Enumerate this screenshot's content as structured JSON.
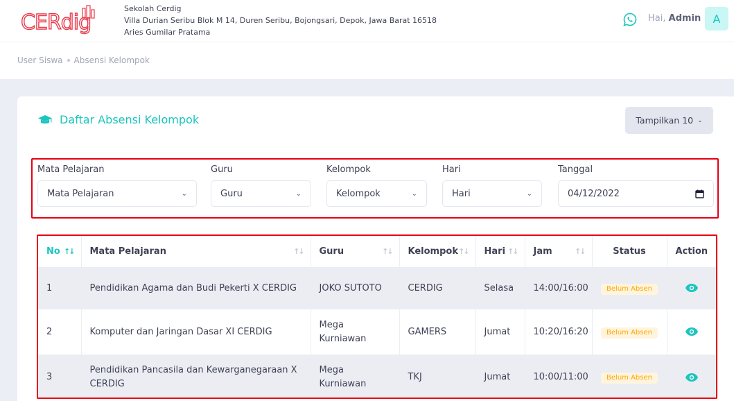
{
  "header": {
    "logo_text": "CERdig",
    "school_name": "Sekolah Cerdig",
    "school_address": "Villa Durian Seribu Blok M 14, Duren Seribu, Bojongsari, Depok, Jawa Barat 16518",
    "principal": "Aries Gumilar Pratama",
    "greeting": "Hai,",
    "user_name": "Admin",
    "avatar_initial": "A",
    "icons": [
      "whatsapp-icon"
    ]
  },
  "breadcrumb": {
    "items": [
      "User Siswa",
      "Absensi Kelompok"
    ]
  },
  "card": {
    "title": "Daftar Absensi Kelompok",
    "title_icon": "graduation-cap-icon",
    "show_label": "Tampilkan 10"
  },
  "filters": {
    "mapel": {
      "label": "Mata Pelajaran",
      "value": "Mata Pelajaran"
    },
    "guru": {
      "label": "Guru",
      "value": "Guru"
    },
    "kelompok": {
      "label": "Kelompok",
      "value": "Kelompok"
    },
    "hari": {
      "label": "Hari",
      "value": "Hari"
    },
    "tanggal": {
      "label": "Tanggal",
      "value": "04/12/2022"
    }
  },
  "table": {
    "headers": [
      "No",
      "Mata Pelajaran",
      "Guru",
      "Kelompok",
      "Hari",
      "Jam",
      "Status",
      "Action"
    ],
    "rows": [
      {
        "no": "1",
        "mapel": "Pendidikan Agama dan Budi Pekerti X CERDIG",
        "guru": "JOKO SUTOTO",
        "kelompok": "CERDIG",
        "hari": "Selasa",
        "jam": "14:00/16:00",
        "status": "Belum Absen"
      },
      {
        "no": "2",
        "mapel": "Komputer dan Jaringan Dasar XI CERDIG",
        "guru": "Mega Kurniawan",
        "kelompok": "GAMERS",
        "hari": "Jumat",
        "jam": "10:20/16:20",
        "status": "Belum Absen"
      },
      {
        "no": "3",
        "mapel": "Pendidikan Pancasila dan Kewarganegaraan X CERDIG",
        "guru": "Mega Kurniawan",
        "kelompok": "TKJ",
        "hari": "Jumat",
        "jam": "10:00/11:00",
        "status": "Belum Absen"
      }
    ]
  },
  "colors": {
    "accent": "#1bc5bd",
    "logo_red": "#e8394a",
    "highlight_border": "#e60012",
    "badge_bg": "#fff4de",
    "badge_text": "#ffa800"
  }
}
